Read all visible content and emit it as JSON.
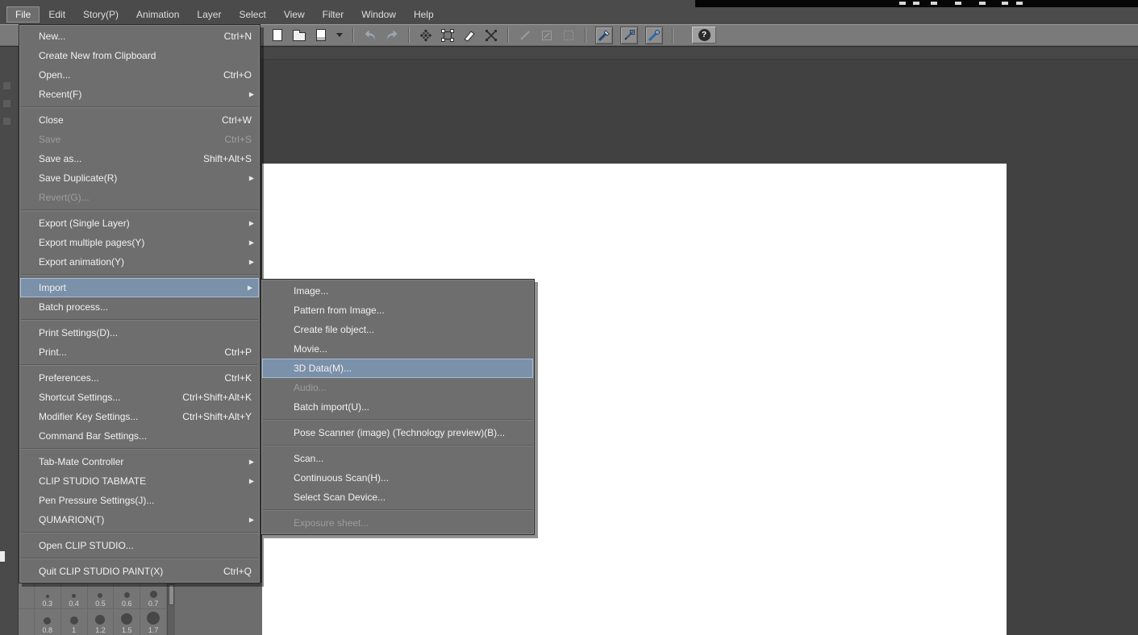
{
  "app": {
    "name": "CLIP STUDIO PAINT"
  },
  "glyphs": {
    "submenu_arrow": "▶"
  },
  "menubar": {
    "items": [
      "File",
      "Edit",
      "Story(P)",
      "Animation",
      "Layer",
      "Select",
      "View",
      "Filter",
      "Window",
      "Help"
    ],
    "active_item": "File"
  },
  "toolbar": {
    "help_label": "?",
    "icons": [
      "new-file-icon",
      "open-file-icon",
      "save-file-icon",
      "save-options-dropdown-icon",
      "undo-icon",
      "redo-icon",
      "screentone-icon",
      "object-handles-icon",
      "blend-wedge-icon",
      "mesh-transform-icon",
      "slash-disabled-icon",
      "pen-box-disabled-icon",
      "dotted-box-disabled-icon",
      "snap-to-ruler-icon",
      "snap-to-special-ruler-icon",
      "snap-to-grid-icon",
      "help-icon"
    ]
  },
  "file_menu": {
    "items": [
      {
        "label": "New...",
        "shortcut": "Ctrl+N"
      },
      {
        "label": "Create New from Clipboard",
        "shortcut": ""
      },
      {
        "label": "Open...",
        "shortcut": "Ctrl+O"
      },
      {
        "label": "Recent(F)",
        "submenu": true
      },
      {
        "label": "Close",
        "shortcut": "Ctrl+W"
      },
      {
        "label": "Save",
        "shortcut": "Ctrl+S",
        "disabled": true
      },
      {
        "label": "Save as...",
        "shortcut": "Shift+Alt+S"
      },
      {
        "label": "Save Duplicate(R)",
        "submenu": true
      },
      {
        "label": "Revert(G)...",
        "shortcut": "",
        "disabled": true
      },
      {
        "label": "Export (Single Layer)",
        "submenu": true
      },
      {
        "label": "Export multiple pages(Y)",
        "submenu": true
      },
      {
        "label": "Export animation(Y)",
        "submenu": true
      },
      {
        "label": "Import",
        "submenu": true,
        "selected": true
      },
      {
        "label": "Batch process...",
        "shortcut": ""
      },
      {
        "label": "Print Settings(D)...",
        "shortcut": ""
      },
      {
        "label": "Print...",
        "shortcut": "Ctrl+P"
      },
      {
        "label": "Preferences...",
        "shortcut": "Ctrl+K"
      },
      {
        "label": "Shortcut Settings...",
        "shortcut": "Ctrl+Shift+Alt+K"
      },
      {
        "label": "Modifier Key Settings...",
        "shortcut": "Ctrl+Shift+Alt+Y"
      },
      {
        "label": "Command Bar Settings...",
        "shortcut": ""
      },
      {
        "label": "Tab-Mate Controller",
        "submenu": true
      },
      {
        "label": "CLIP STUDIO TABMATE",
        "submenu": true
      },
      {
        "label": "Pen Pressure Settings(J)...",
        "shortcut": ""
      },
      {
        "label": "QUMARION(T)",
        "submenu": true
      },
      {
        "label": "Open CLIP STUDIO...",
        "shortcut": ""
      },
      {
        "label": "Quit CLIP STUDIO PAINT(X)",
        "shortcut": "Ctrl+Q"
      }
    ]
  },
  "import_submenu": {
    "items": [
      {
        "label": "Image..."
      },
      {
        "label": "Pattern from Image..."
      },
      {
        "label": "Create file object..."
      },
      {
        "label": "Movie..."
      },
      {
        "label": "3D Data(M)...",
        "selected": true
      },
      {
        "label": "Audio...",
        "disabled": true
      },
      {
        "label": "Batch import(U)..."
      },
      {
        "label": "Pose Scanner (image) (Technology preview)(B)..."
      },
      {
        "label": "Scan..."
      },
      {
        "label": "Continuous Scan(H)..."
      },
      {
        "label": "Select Scan Device..."
      },
      {
        "label": "Exposure sheet...",
        "disabled": true
      }
    ]
  },
  "brush_size_palette": {
    "row1_labels": [
      "0.3",
      "0.4",
      "0.5",
      "0.6",
      "0.7"
    ],
    "row2_labels": [
      "0.8",
      "1",
      "1.2",
      "1.5",
      "1.7"
    ]
  },
  "colors": {
    "selection_highlight": "#7b90a9",
    "selection_border": "#a6bdd7",
    "menu_background": "#6e6e6e",
    "menubar_background": "#4b4b4b",
    "toolbar_background": "#7a7a7a",
    "workspace_background": "#414141",
    "canvas": "#ffffff"
  }
}
